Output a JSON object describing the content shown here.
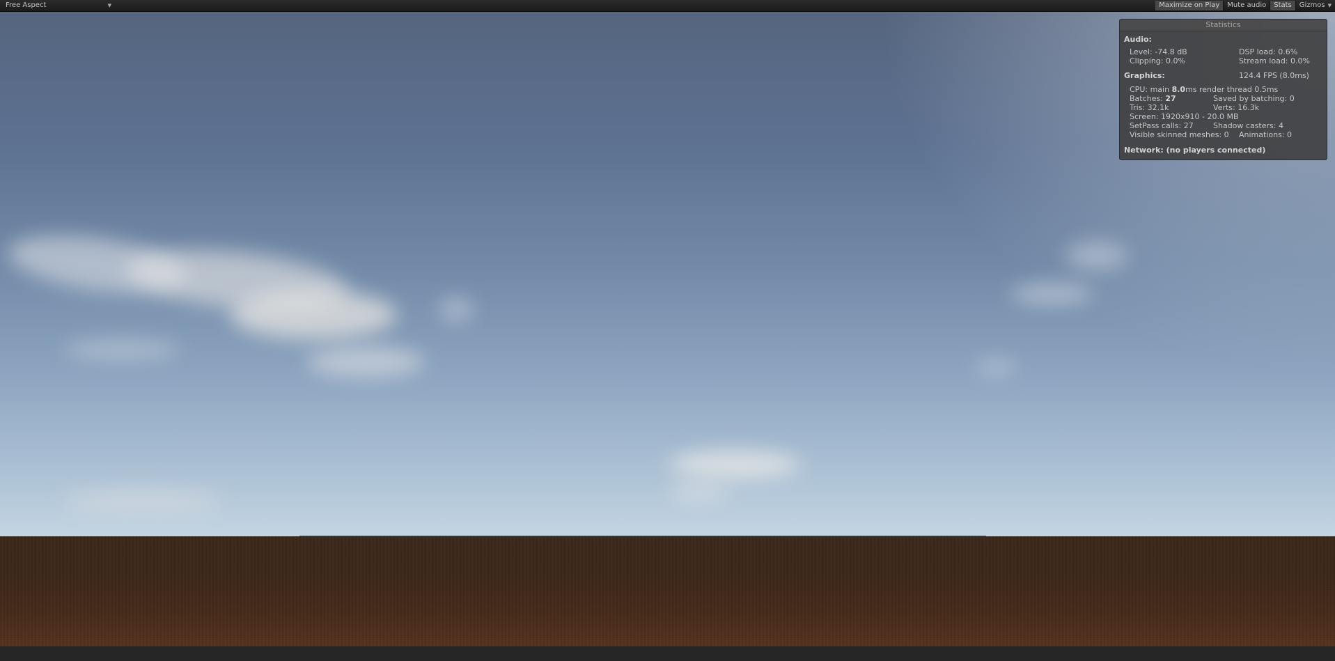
{
  "toolbar": {
    "aspect": "Free Aspect",
    "buttons": {
      "maximize_on_play": "Maximize on Play",
      "mute_audio": "Mute audio",
      "stats": "Stats",
      "gizmos": "Gizmos"
    }
  },
  "stats": {
    "title": "Statistics",
    "audio": {
      "header": "Audio:",
      "level": "Level: -74.8 dB",
      "dsp_load": "DSP load: 0.6%",
      "clipping": "Clipping: 0.0%",
      "stream_load": "Stream load: 0.0%"
    },
    "graphics": {
      "header": "Graphics:",
      "fps": "124.4 FPS (8.0ms)",
      "cpu_prefix": "CPU: main ",
      "cpu_main": "8.0",
      "cpu_suffix": "ms  render thread 0.5ms",
      "batches_prefix": "Batches: ",
      "batches": "27",
      "saved_by_batching": "Saved by batching: 0",
      "tris": "Tris: 32.1k",
      "verts": "Verts: 16.3k",
      "screen": "Screen: 1920x910 - 20.0 MB",
      "setpass": "SetPass calls: 27",
      "shadow_casters": "Shadow casters: 4",
      "visible_skinned": "Visible skinned meshes: 0",
      "animations": "Animations: 0"
    },
    "network": "Network: (no players connected)"
  },
  "colors": {
    "toolbar_bg": "#1f1f1f",
    "active_button": "#484848",
    "panel_bg": "#3c3c3c",
    "sky_top": "#55657f",
    "sky_horizon": "#c4d5e2",
    "ground": "#402a1c"
  },
  "icons": {
    "aspect_dropdown": "chevron-down-icon",
    "gizmos_dropdown": "chevron-down-icon"
  }
}
